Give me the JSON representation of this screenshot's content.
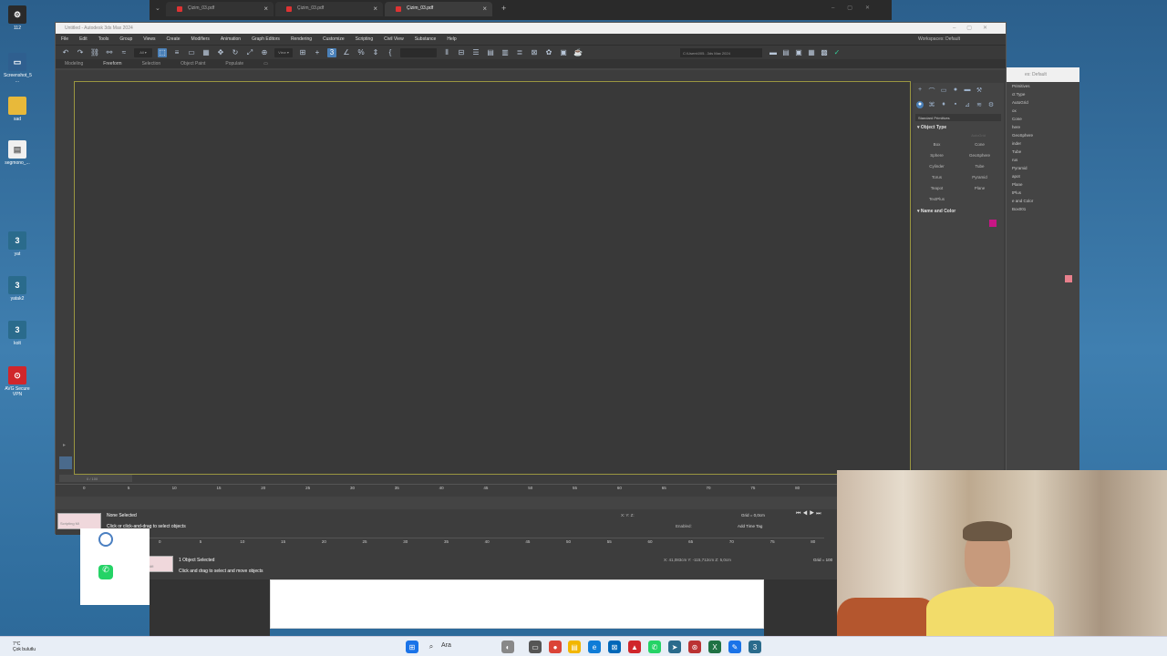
{
  "desktop_icons": [
    {
      "label": "112",
      "color": "#2a2a2a",
      "glyph": "⚙"
    },
    {
      "label": "Screenshot_5 ...",
      "color": "#2f5f8f",
      "glyph": "▭"
    },
    {
      "label": "sad",
      "color": "#e8b93a",
      "glyph": "▭"
    },
    {
      "label": "segmono_...",
      "color": "#f0f0f0",
      "glyph": "▤"
    },
    {
      "label": "yat",
      "color": "#2a6b8c",
      "glyph": "3"
    },
    {
      "label": "yatak2",
      "color": "#2a6b8c",
      "glyph": "3"
    },
    {
      "label": "kolt",
      "color": "#2a6b8c",
      "glyph": "3"
    },
    {
      "label": "AVG Secure VPN",
      "color": "#d0262b",
      "glyph": "⊙"
    }
  ],
  "browser": {
    "tabs": [
      {
        "label": "Çizim_03.pdf"
      },
      {
        "label": "Çizim_03.pdf"
      },
      {
        "label": "Çizim_03.pdf"
      }
    ],
    "new_tab": "+"
  },
  "max": {
    "title": "Untitled - Autodesk 3ds Max 2024",
    "menu": [
      "File",
      "Edit",
      "Tools",
      "Group",
      "Views",
      "Create",
      "Modifiers",
      "Animation",
      "Graph Editors",
      "Rendering",
      "Customize",
      "Scripting",
      "Civil View",
      "Substance",
      "Help"
    ],
    "workspace": "Workspaces: Default",
    "path": "C:\\Users\\005...3ds Max 2024",
    "ribbon": [
      "Modeling",
      "Freeform",
      "Selection",
      "Object Paint",
      "Populate"
    ],
    "command_panel": {
      "dropdown": "Standard Primitives",
      "object_type_title": "Object Type",
      "autogrid": "AutoGrid",
      "buttons": [
        "Box",
        "Cone",
        "Sphere",
        "GeoSphere",
        "Cylinder",
        "Tube",
        "Torus",
        "Pyramid",
        "Teapot",
        "Plane",
        "TextPlus"
      ],
      "name_color_title": "Name and Color",
      "swatch_color": "#c71585"
    },
    "timeline": {
      "slider": "0 / 100",
      "ticks": [
        "0",
        "5",
        "10",
        "15",
        "20",
        "25",
        "30",
        "35",
        "40",
        "45",
        "50",
        "55",
        "60",
        "65",
        "70",
        "75",
        "80"
      ]
    },
    "status": {
      "script": "Scripting Mi",
      "selected": "None Selected",
      "hint": "Click or click-and-drag to select objects",
      "coords": "X:        Y:        Z:",
      "grid": "Grid = 0,0cm",
      "time_tag": "Add Time Tag",
      "enabled": "Enabled:"
    }
  },
  "max2": {
    "script": "Array modifi",
    "selected": "1 Object Selected",
    "hint": "Click and drag to select and move objects",
    "coords": "X: 41,083cm  Y: -115,712cm  Z: 5,0cm",
    "grid": "Grid = 100"
  },
  "max3": {
    "workspace": "es: Default",
    "rows": [
      "Primitives",
      "ct Type",
      "AutoGrid",
      "ox",
      "Cone",
      "here",
      "GeoSphere",
      "inder",
      "Tube",
      "rus",
      "Pyramid",
      "apot",
      "Plane",
      "tPlus",
      "e and Color",
      "Box001"
    ]
  },
  "taskbar": {
    "weather_temp": "7°C",
    "weather_desc": "Çok bulutlu",
    "search": "Ara"
  }
}
